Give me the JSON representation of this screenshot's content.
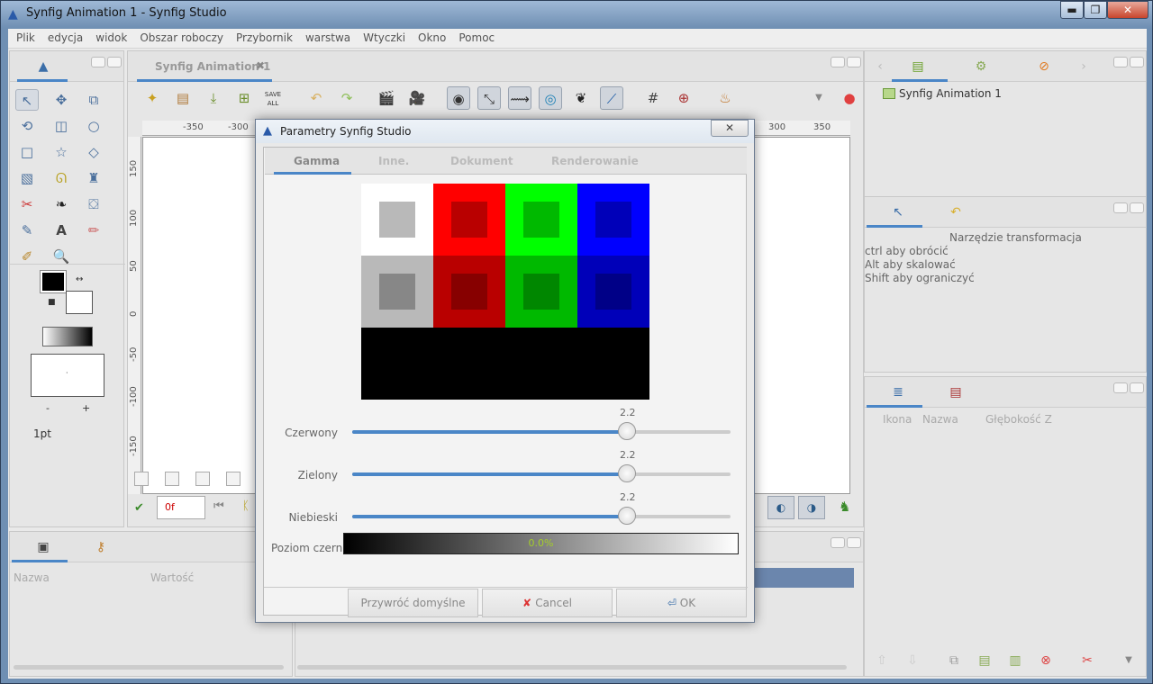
{
  "window": {
    "title": "Synfig Animation 1 - Synfig Studio",
    "min": "▬",
    "max": "❐",
    "close": "✕"
  },
  "menu": [
    "Plik",
    "edycja",
    "widok",
    "Obszar roboczy",
    "Przybornik",
    "warstwa",
    "Wtyczki",
    "Okno",
    "Pomoc"
  ],
  "document_tab": {
    "label": "Synfig Animation 1",
    "close": "✖"
  },
  "toolbar": {
    "save_all": "SAVE ALL"
  },
  "ruler_h": [
    "-350",
    "-300",
    "300",
    "350"
  ],
  "ruler_v": [
    "150",
    "100",
    "50",
    "0",
    "-50",
    "-100",
    "-150"
  ],
  "toolbox": {
    "width_label": "1pt",
    "minus": "-",
    "plus": "+"
  },
  "frame_field": "0f",
  "params": {
    "col_name": "Nazwa",
    "col_value": "Wartość"
  },
  "canvas_browser": {
    "item": "Synfig Animation 1"
  },
  "tool_options": {
    "title": "Narzędzie transformacja",
    "hints": [
      "ctrl aby obrócić",
      "Alt aby skalować",
      "Shift aby ograniczyć"
    ]
  },
  "layers": {
    "cols": [
      "Ikona",
      "Nazwa",
      "Głębokość Z"
    ]
  },
  "dialog": {
    "title": "Parametry Synfig Studio",
    "close": "✕",
    "tabs": [
      "Gamma",
      "Inne.",
      "Dokument",
      "Renderowanie"
    ],
    "active_tab": "Gamma",
    "sliders": [
      {
        "label": "Czerwony",
        "value": "2.2",
        "fraction": 0.726
      },
      {
        "label": "Zielony",
        "value": "2.2",
        "fraction": 0.726
      },
      {
        "label": "Niebieski",
        "value": "2.2",
        "fraction": 0.726
      }
    ],
    "black_level": {
      "label": "Poziom czerni",
      "value": "0.0%"
    },
    "buttons": {
      "reset": "Przywróć domyślne",
      "cancel": "Cancel",
      "ok": "OK"
    }
  },
  "colors": {
    "accent": "#4a86c7",
    "red": "#ff0000",
    "green": "#00ff00",
    "blue": "#0000ff"
  }
}
